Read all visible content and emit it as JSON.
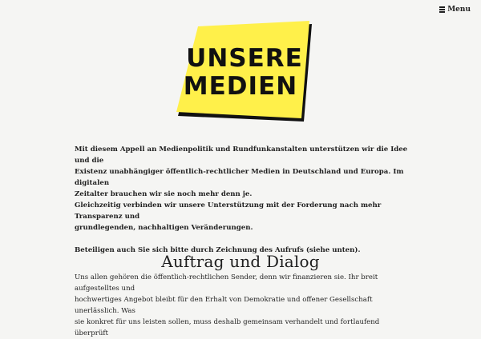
{
  "nav": {
    "menu_label": "Menu",
    "menu_icon": "hamburger-icon"
  },
  "logo": {
    "line1": "UNSERE",
    "line2": "MEDIEN",
    "bg_color": "#fff04a",
    "ink_color": "#111111"
  },
  "intro": {
    "line1": "Mit diesem Appell an Medienpolitik und Rundfunkanstalten unterstützen wir die Idee und die",
    "line2": "Existenz unabhängiger öffentlich-rechtlicher Medien in Deutschland und Europa. Im digitalen",
    "line3": "Zeitalter brauchen wir sie noch mehr denn je.",
    "line4": "Gleichzeitig verbinden wir unsere Unterstützung mit der Forderung nach mehr Transparenz und",
    "line5": "grundlegenden, nachhaltigen Veränderungen.",
    "cta": "Beteiligen auch Sie sich bitte durch Zeichnung des Aufrufs (siehe unten)."
  },
  "section": {
    "title": "Auftrag und Dialog",
    "line1": "Uns allen gehören die öffentlich-rechtlichen Sender, denn wir finanzieren sie. Ihr breit aufgestelltes und",
    "line2": "hochwertiges Angebot bleibt für den Erhalt von Demokratie und offener Gesellschaft unerlässlich. Was",
    "line3": "sie konkret für uns leisten sollen, muss deshalb gemeinsam verhandelt und fortlaufend überprüft"
  }
}
